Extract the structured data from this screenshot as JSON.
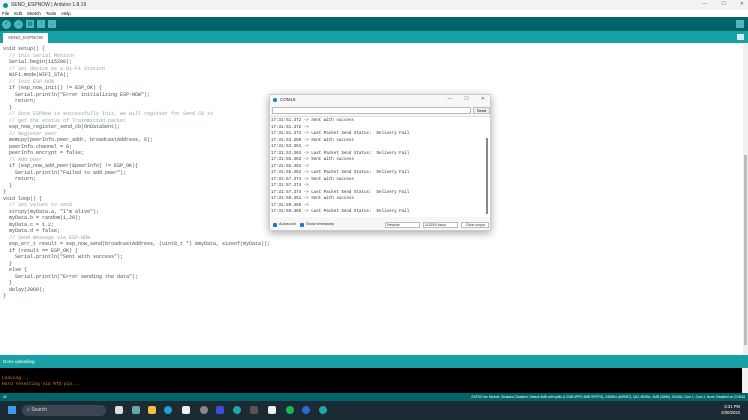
{
  "window": {
    "title": "SEND_ESPNOW | Arduino 1.8.19",
    "controls": [
      "—",
      "☐",
      "✕"
    ]
  },
  "menu": [
    "File",
    "Edit",
    "Sketch",
    "Tools",
    "Help"
  ],
  "toolbar": {
    "verify": "✓",
    "upload": "→",
    "new": "▤",
    "open": "↑",
    "save": "↓"
  },
  "tab": "SEND_ESPNOW",
  "code": [
    "void setup() {",
    "  // Init Serial Monitor",
    "  Serial.begin(115200);",
    "",
    "  // Set device as a Wi-Fi Station",
    "  WiFi.mode(WIFI_STA);",
    "",
    "  // Init ESP-NOW",
    "  if (esp_now_init() != ESP_OK) {",
    "    Serial.println(\"Error initializing ESP-NOW\");",
    "    return;",
    "  }",
    "",
    "  // Once ESPNow is successfully Init, we will register for Send CB to",
    "  // get the status of Trasnmitted packet",
    "  esp_now_register_send_cb(OnDataSent);",
    "",
    "  // Register peer",
    "  memcpy(peerInfo.peer_addr, broadcastAddress, 6);",
    "  peerInfo.channel = 0;",
    "  peerInfo.encrypt = false;",
    "",
    "  // Add peer",
    "  if (esp_now_add_peer(&peerInfo) != ESP_OK){",
    "    Serial.println(\"Failed to add peer\");",
    "    return;",
    "  }",
    "}",
    "",
    "void loop() {",
    "  // Set values to send",
    "  strcpy(myData.a, \"I'm alive\");",
    "  myData.b = random(1,20);",
    "  myData.c = 1.2;",
    "  myData.d = false;",
    "",
    "  // Send message via ESP-NOW",
    "  esp_err_t result = esp_now_send(broadcastAddress, (uint8_t *) &myData, sizeof(myData));",
    "",
    "  if (result == ESP_OK) {",
    "    Serial.println(\"Sent with success\");",
    "  }",
    "  else {",
    "    Serial.println(\"Error sending the data\");",
    "  }",
    "  delay(2000);",
    "}"
  ],
  "status": "Done uploading",
  "console": [
    "Leaving...",
    "Hard resetting via RTS pin..."
  ],
  "bottom": {
    "line": "49",
    "board": "ESP32 Dev Module, Disabled, Disabled, Default 4MB with spiffs (1.2MB APP/1.5MB SPIFFS), 240MHz (WiFi/BT), QIO, 80MHz, 4MB (32Mb), 921600, Core 1, Core 1, None, Disabled on COM18"
  },
  "monitor": {
    "title": "COM18",
    "controls": [
      "—",
      "☐",
      "✕"
    ],
    "send": "Send",
    "output": [
      "17:31:51.372 -> Sent with success",
      "17:31:51.372 -> ",
      "17:31:51.372 -> Last Packet Send Status:\tDelivery Fail",
      "17:31:53.350 -> Sent with success",
      "17:31:53.363 -> ",
      "17:31:53.363 -> Last Packet Send Status:\tDelivery Fail",
      "17:31:55.363 -> Sent with success",
      "17:31:55.363 -> ",
      "17:31:55.363 -> Last Packet Send Status:\tDelivery Fail",
      "17:31:57.374 -> Sent with success",
      "17:31:57.374 -> ",
      "17:31:57.374 -> Last Packet Send Status:\tDelivery Fail",
      "17:31:59.351 -> Sent with success",
      "17:31:59.365 -> ",
      "17:31:59.365 -> Last Packet Send Status:\tDelivery Fail"
    ],
    "autoscroll": "Autoscroll",
    "timestamp": "Show timestamp",
    "line_ending": "Newline",
    "baud": "115200 baud",
    "clear": "Clear output"
  },
  "taskbar": {
    "search": "Search",
    "time": "5:31 PM",
    "date": "6/30/2023"
  }
}
